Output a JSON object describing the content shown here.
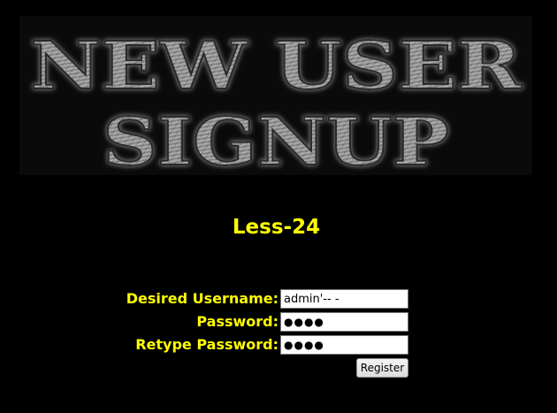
{
  "banner": {
    "line1": "NEW USER",
    "line2": "SIGNUP"
  },
  "lesson_title": "Less-24",
  "form": {
    "username_label": "Desired Username:",
    "username_value": "admin'-- -",
    "password_label": "Password:",
    "password_masked": "●●●●",
    "retype_label": "Retype Password:",
    "retype_masked": "●●●●",
    "register_label": "Register"
  },
  "colors": {
    "background": "#000000",
    "label_text": "#ffff00",
    "banner_text": "#8a8a8a"
  }
}
